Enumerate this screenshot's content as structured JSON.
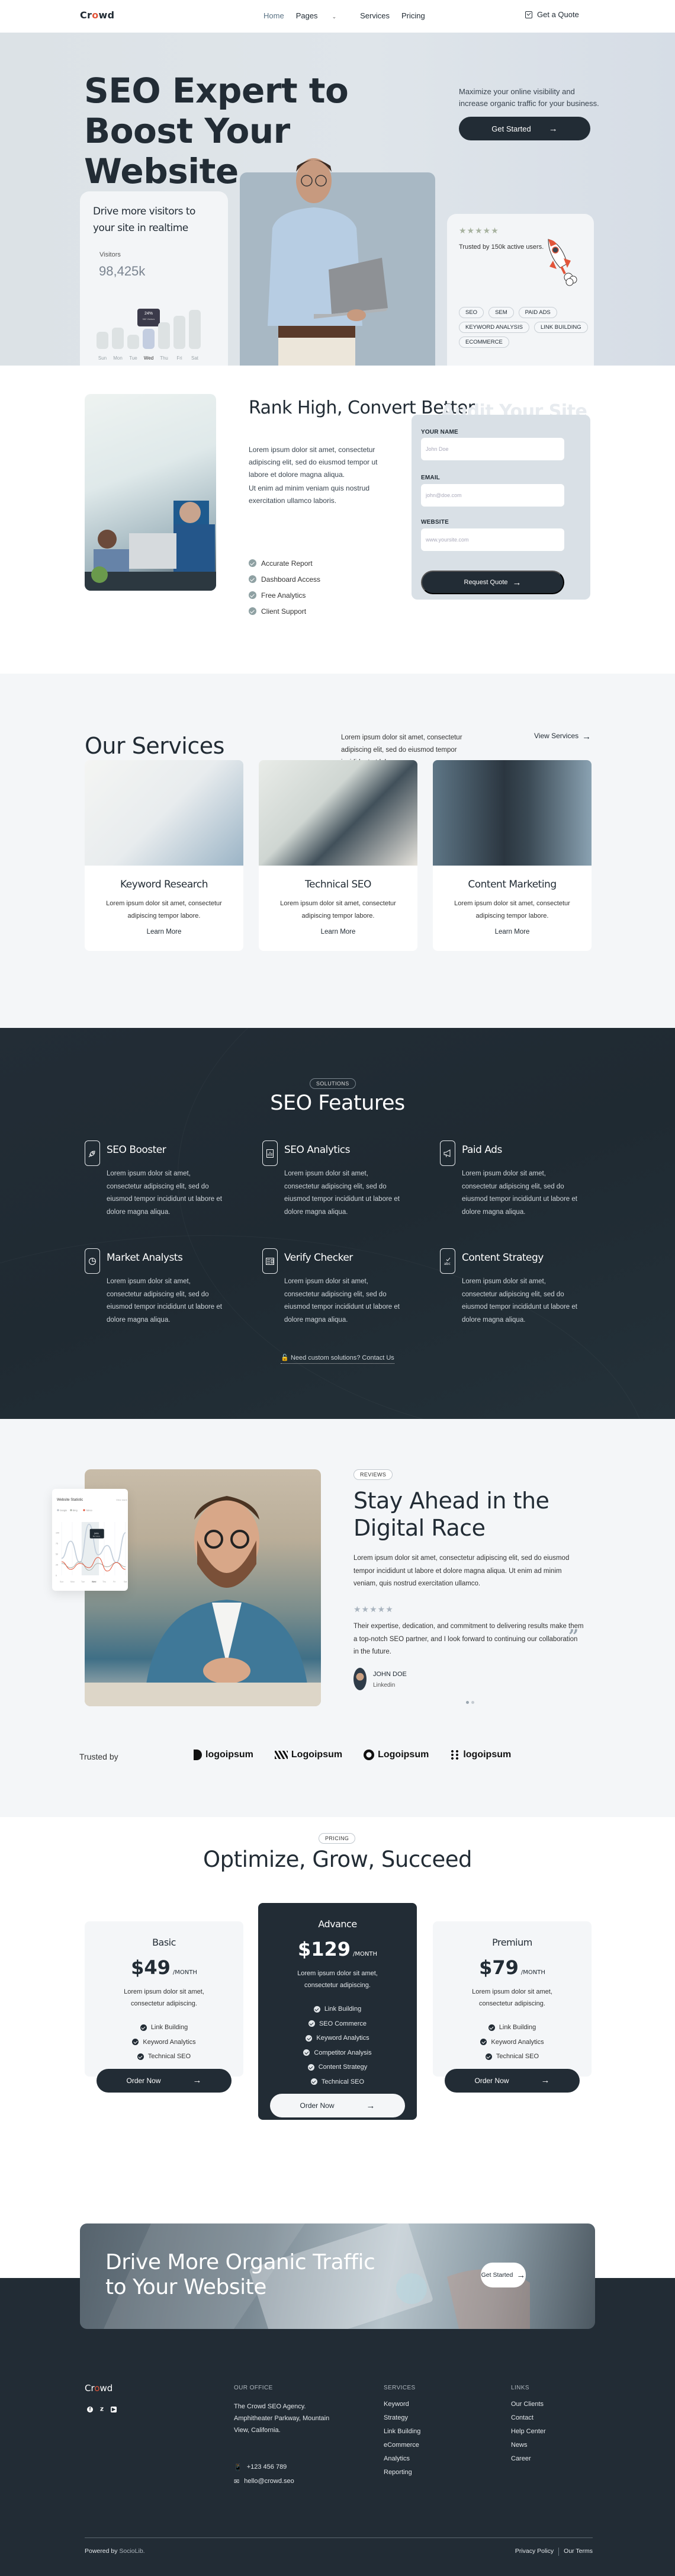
{
  "nav": {
    "logo_prefix": "Cr",
    "logo_accent": "o",
    "logo_suffix": "wd",
    "items": [
      {
        "label": "Home",
        "active": true
      },
      {
        "label": "Pages",
        "has_dropdown": true
      },
      {
        "label": "Services"
      },
      {
        "label": "Pricing"
      }
    ],
    "quote_label": "Get a Quote"
  },
  "hero": {
    "title": "SEO Expert to Boost Your Website",
    "subtitle": "Maximize your online visibility and increase organic traffic for your business.",
    "cta_label": "Get Started",
    "visitors_card": {
      "title": "Drive more visitors to your site in realtime",
      "label": "Visitors",
      "value": "98,425k",
      "tooltip_value": "24%",
      "tooltip_sub": "982 Visitors"
    },
    "trust_card": {
      "stars": "★★★★★",
      "text": "Trusted by 150k active users.",
      "tags": [
        "SEO",
        "SEM",
        "PAID ADS",
        "KEYWORD ANALYSIS",
        "LINK BUILDING",
        "ECOMMERCE"
      ]
    }
  },
  "chart_data": [
    {
      "type": "bar",
      "title": "Visitors",
      "categories": [
        "Sun",
        "Mon",
        "Tue",
        "Wed",
        "Thu",
        "Fri",
        "Sat"
      ],
      "values": [
        42,
        52,
        35,
        48,
        65,
        80,
        95
      ],
      "highlight": "Wed",
      "annotation": "24% · 982 Visitors",
      "ylim": [
        0,
        100
      ]
    },
    {
      "type": "line",
      "title": "Website Statistic",
      "action": "View more",
      "categories": [
        "Sun",
        "Mon",
        "Tue",
        "Wed",
        "Thu",
        "Fri",
        "Sat"
      ],
      "series": [
        {
          "name": "Google",
          "values": [
            40,
            80,
            30,
            120,
            48,
            70,
            30,
            100
          ]
        },
        {
          "name": "Bing",
          "values": [
            28,
            18,
            32,
            12,
            28,
            20,
            30,
            20
          ]
        },
        {
          "name": "Yahoo",
          "values": [
            32,
            14,
            28,
            18,
            42,
            10,
            30,
            14
          ]
        }
      ],
      "yticks": [
        0,
        25,
        50,
        75,
        100
      ],
      "ylim": [
        0,
        125
      ],
      "highlight": "Wed",
      "annotation": "24% · 982 Visitors"
    }
  ],
  "rank": {
    "title": "Rank High, Convert Better",
    "para1": "Lorem ipsum dolor sit amet, consectetur adipiscing elit, sed do eiusmod tempor ut labore et dolore magna aliqua.",
    "para2": "Ut enim ad minim veniam quis nostrud exercitation ullamco laboris.",
    "checks": [
      "Accurate Report",
      "Dashboard Access",
      "Free Analytics",
      "Client Support"
    ],
    "form": {
      "ghost_title": "Audit Your Site",
      "name_label": "YOUR NAME",
      "name_placeholder": "John Doe",
      "email_label": "EMAIL",
      "email_placeholder": "john@doe.com",
      "website_label": "WEBSITE",
      "website_placeholder": "www.yoursite.com",
      "submit_label": "Request Quote"
    }
  },
  "services": {
    "title": "Our Services",
    "description": "Lorem ipsum dolor sit amet, consectetur adipiscing elit, sed do eiusmod tempor incididunt ut labore.",
    "view_label": "View Services",
    "cards": [
      {
        "title": "Keyword Research",
        "text": "Lorem ipsum dolor sit amet, consectetur adipiscing tempor labore.",
        "link": "Learn More"
      },
      {
        "title": "Technical SEO",
        "text": "Lorem ipsum dolor sit amet, consectetur adipiscing tempor labore.",
        "link": "Learn More"
      },
      {
        "title": "Content Marketing",
        "text": "Lorem ipsum dolor sit amet, consectetur adipiscing tempor labore.",
        "link": "Learn More"
      }
    ]
  },
  "features": {
    "pill": "SOLUTIONS",
    "title": "SEO Features",
    "items": [
      {
        "title": "SEO Booster",
        "icon": "rocket-icon",
        "text": "Lorem ipsum dolor sit amet, consectetur adipiscing elit, sed do eiusmod tempor incididunt ut labore et dolore magna aliqua."
      },
      {
        "title": "SEO Analytics",
        "icon": "bar-chart-icon",
        "text": "Lorem ipsum dolor sit amet, consectetur adipiscing elit, sed do eiusmod tempor incididunt ut labore et dolore magna aliqua."
      },
      {
        "title": "Paid Ads",
        "icon": "megaphone-icon",
        "text": "Lorem ipsum dolor sit amet, consectetur adipiscing elit, sed do eiusmod tempor incididunt ut labore et dolore magna aliqua."
      },
      {
        "title": "Market Analysts",
        "icon": "pie-chart-icon",
        "text": "Lorem ipsum dolor sit amet, consectetur adipiscing elit, sed do eiusmod tempor incididunt ut labore et dolore magna aliqua."
      },
      {
        "title": "Verify Checker",
        "icon": "id-card-icon",
        "text": "Lorem ipsum dolor sit amet, consectetur adipiscing elit, sed do eiusmod tempor incididunt ut labore et dolore magna aliqua."
      },
      {
        "title": "Content Strategy",
        "icon": "spellcheck-icon",
        "text": "Lorem ipsum dolor sit amet, consectetur adipiscing elit, sed do eiusmod tempor incididunt ut labore et dolore magna aliqua."
      }
    ],
    "contact_label": "Need custom solutions? Contact Us"
  },
  "reviews": {
    "pill": "REVIEWS",
    "title": "Stay Ahead in the Digital Race",
    "text": "Lorem ipsum dolor sit amet, consectetur adipiscing elit, sed do eiusmod tempor incididunt ut labore et dolore magna aliqua. Ut enim ad minim veniam, quis nostrud exercitation ullamco.",
    "stars": "★★★★★",
    "quote": "Their expertise, dedication, and commitment to delivering results make them a top-notch SEO partner, and I look forward to continuing our collaboration in the future.",
    "author": "JOHN DOE",
    "author_role": "Linkedin",
    "stat_card": {
      "title": "Website Statistic",
      "action": "View more",
      "legend": [
        "Google",
        "Bing",
        "Yahoo"
      ],
      "legend_colors": [
        "#b5bcc4",
        "#a9b0a8",
        "#e2553a"
      ],
      "tooltip_value": "24%",
      "tooltip_sub": "982 Visitors"
    }
  },
  "trusted": {
    "label": "Trusted by",
    "logos": [
      "logoipsum",
      "Logoipsum",
      "Logoipsum",
      "logoipsum"
    ]
  },
  "pricing": {
    "pill": "PRICING",
    "title": "Optimize, Grow, Succeed",
    "plans": [
      {
        "name": "Basic",
        "price": "$49",
        "period": "/MONTH",
        "desc": "Lorem ipsum dolor sit amet, consectetur adipiscing.",
        "features": [
          "Link Building",
          "Keyword Analytics",
          "Technical SEO"
        ],
        "cta": "Order Now"
      },
      {
        "name": "Advance",
        "price": "$129",
        "period": "/MONTH",
        "desc": "Lorem ipsum dolor sit amet, consectetur adipiscing.",
        "features": [
          "Link Building",
          "SEO Commerce",
          "Keyword Analytics",
          "Competitor Analysis",
          "Content Strategy",
          "Technical SEO"
        ],
        "cta": "Order Now",
        "featured": true
      },
      {
        "name": "Premium",
        "price": "$79",
        "period": "/MONTH",
        "desc": "Lorem ipsum dolor sit amet, consectetur adipiscing.",
        "features": [
          "Link Building",
          "Keyword Analytics",
          "Technical SEO"
        ],
        "cta": "Order Now"
      }
    ]
  },
  "cta": {
    "title": "Drive More Organic Traffic to Your Website",
    "button": "Get Started"
  },
  "footer": {
    "office_heading": "OUR OFFICE",
    "address": "The Crowd SEO Agency. Amphitheater Parkway, Mountain View, California.",
    "phone": "+123 456 789",
    "email": "hello@crowd.seo",
    "services_heading": "SERVICES",
    "services": [
      "Keyword",
      "Strategy",
      "Link Building",
      "eCommerce",
      "Analytics",
      "Reporting"
    ],
    "links_heading": "LINKS",
    "links": [
      "Our Clients",
      "Contact",
      "Help Center",
      "News",
      "Career"
    ],
    "powered_prefix": "Powered by ",
    "powered_brand": "SocioLib.",
    "privacy": "Privacy Policy",
    "terms": "Our Terms"
  },
  "colors": {
    "dark": "#222c35",
    "accent": "#e2553a",
    "light_bg": "#f4f6f8",
    "hero_bg": "#dfe4ea"
  }
}
